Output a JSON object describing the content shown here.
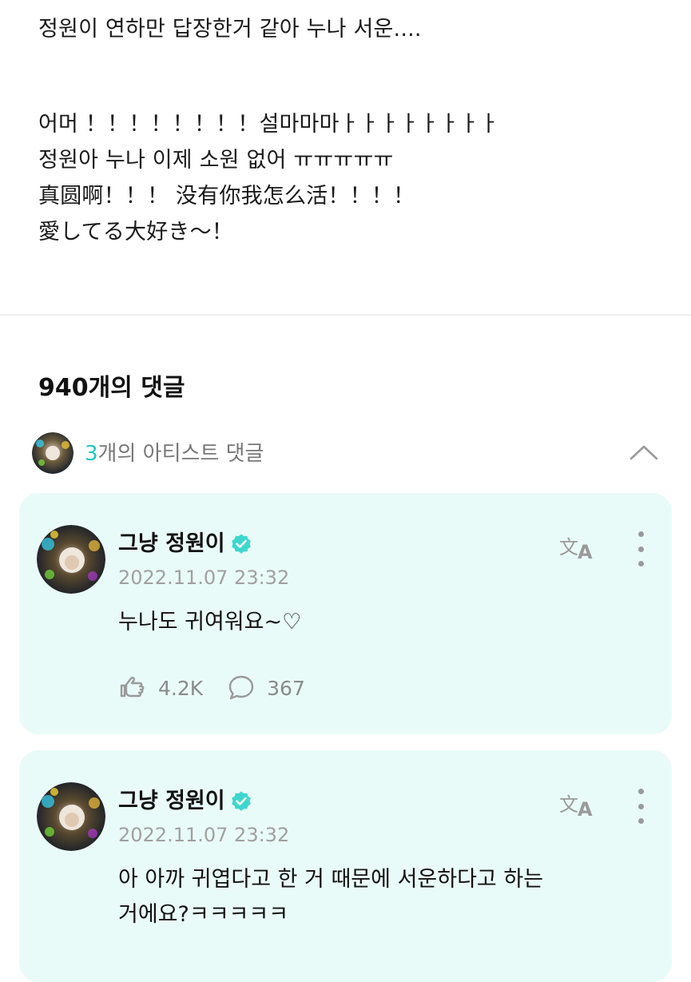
{
  "post": {
    "line1": "정원이 연하만 답장한거 같아 누나 서운....",
    "line2": "어머 ！！！！！！！！설마마마ㅏㅏㅏㅏㅏㅏㅏㅏ",
    "line3": "정원아 누나 이제 소원 없어 ㅠㅠㅠㅠㅠ",
    "line4": "真圆啊！！！ 没有你我怎么活！！！！",
    "line5": "愛してる大好き～！"
  },
  "comments_header": {
    "count_label": "940개의 댓글"
  },
  "artist_comments": {
    "count": "3",
    "label_suffix": "개의 아티스트 댓글"
  },
  "comments": [
    {
      "author": "그냥 정원이",
      "date": "2022.11.07 23:32",
      "text": "누나도 귀여워요~♡",
      "likes": "4.2K",
      "replies": "367"
    },
    {
      "author": "그냥 정원이",
      "date": "2022.11.07 23:32",
      "text_line1": "아 아까 귀엽다고 한 거 때문에 서운하다고 하는",
      "text_line2": "거에요?ㅋㅋㅋㅋㅋ"
    }
  ],
  "colors": {
    "accent": "#1fc7c3",
    "card_bg": "#e9fbf8",
    "verified": "#3ed6cc"
  },
  "icons": [
    "chevron-up-icon",
    "verified-icon",
    "translate-icon",
    "more-icon",
    "cheer-icon",
    "comment-icon"
  ]
}
